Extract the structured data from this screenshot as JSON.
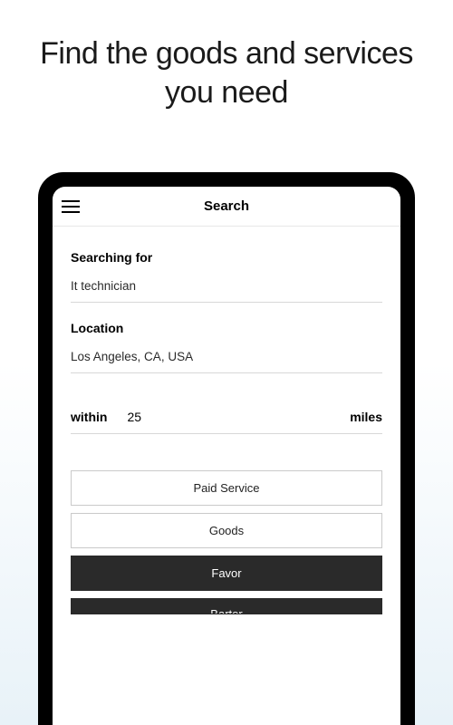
{
  "hero": {
    "title": "Find the goods and services you need"
  },
  "header": {
    "title": "Search"
  },
  "form": {
    "searching_label": "Searching for",
    "searching_value": "It technician",
    "location_label": "Location",
    "location_value": "Los Angeles, CA, USA",
    "within_label": "within",
    "within_value": "25",
    "within_unit": "miles"
  },
  "buttons": {
    "paid_service": "Paid Service",
    "goods": "Goods",
    "favor": "Favor",
    "barter": "Barter"
  }
}
